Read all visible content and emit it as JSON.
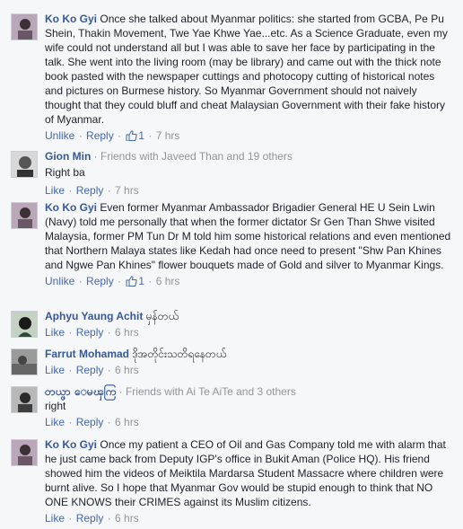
{
  "comments": [
    {
      "name": "Ko Ko Gyi",
      "text": "Once she talked about Myanmar politics: she started from GCBA, Pe Pu Shein, Thakin Movement, Twe Yae Khwe Yae...etc. As a Science Graduate, even my wife could not understand all but I was able to save her face by participating in the talk. She went into the living room (may be library) and came out with the thick note book pasted with the newspaper cuttings and photocopy cutting of historical notes and pictures on Burmese history. So Myanmar Government should not naively thought that they could bluff and cheat Malaysian Government with their fake history of Myanmar.",
      "action": "Unlike",
      "reply": "Reply",
      "likes": "1",
      "time": "7 hrs"
    },
    {
      "name": "Gion Min",
      "friends": "Friends with Javeed Than and 19 others",
      "text": "Right ba",
      "action": "Like",
      "reply": "Reply",
      "time": "7 hrs"
    },
    {
      "name": "Ko Ko Gyi",
      "text": "Even former Myanmar Ambassador Brigadier General HE U Sein Lwin (Navy) told me personally that when the former dictator Sr Gen Than Shwe visited Malaysia, former PM Tun Dr M told him some historical relations and even mentioned that Northern Malaya states like Kedah had once need to present \"Shw Pan Khines and Ngwe Pan Khines\" flower bouquets made of Gold and silver to Myanmar Kings.",
      "action": "Unlike",
      "reply": "Reply",
      "likes": "1",
      "time": "6 hrs"
    },
    {
      "name": "Aphyu Yaung Achit",
      "text": "မှန်တယ်",
      "action": "Like",
      "reply": "Reply",
      "time": "6 hrs"
    },
    {
      "name": "Farrut Mohamad",
      "text": "ဒိုအတိုင်းသတိရနေတယ်",
      "action": "Like",
      "reply": "Reply",
      "time": "6 hrs"
    },
    {
      "name": "တယ္ဖာ ေမၾကြ",
      "friends": "Friends with Ai Te AiTe and 3 others",
      "text": "right",
      "action": "Like",
      "reply": "Reply",
      "time": "6 hrs"
    },
    {
      "name": "Ko Ko Gyi",
      "text": "Once my patient a CEO of Oil and Gas Company told me with alarm that he just came back from Deputy IGP's office in Bukit Aman (Police HQ). His friend showed him the videos of Meiktila Mardarsa Student Massacre where children were burnt alive. So I hope that Myanmar Gov would be stupid enough to think that NO ONE KNOWS their CRIMES against its Muslim citizens.",
      "action": "Like",
      "reply": "Reply",
      "time": "6 hrs"
    }
  ],
  "colors": {
    "name": "#365899",
    "link": "#4267b2",
    "meta": "#90949c",
    "text": "#1d2129",
    "bg": "#f6f7f9"
  },
  "icons": {
    "like": "thumbs-up-icon"
  }
}
